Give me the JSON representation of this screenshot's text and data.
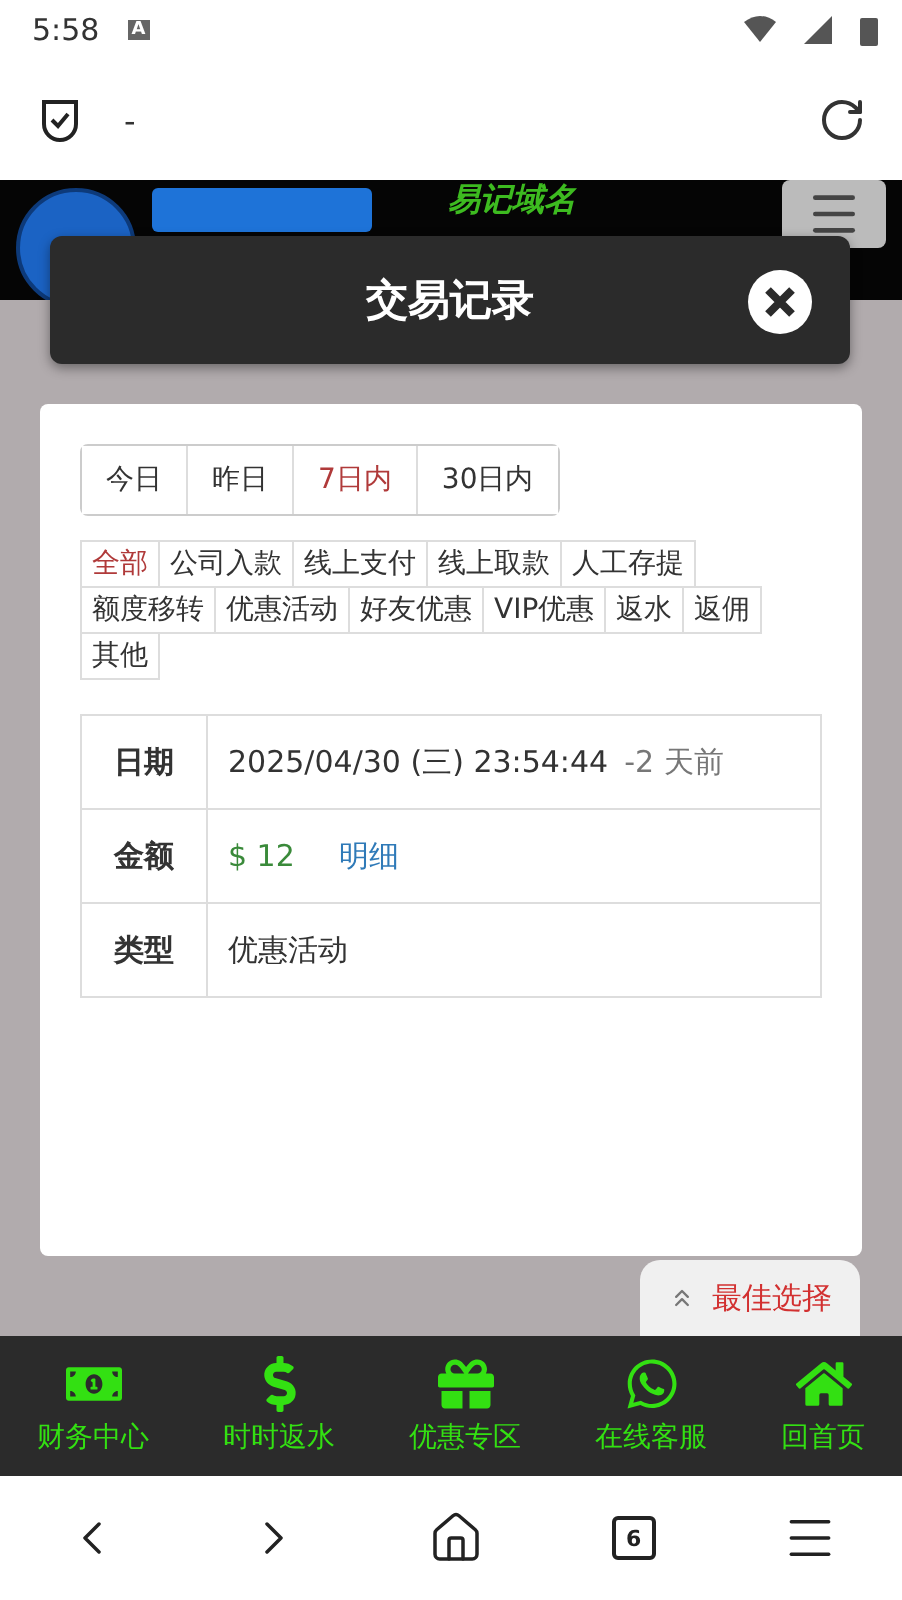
{
  "status_bar": {
    "time": "5:58",
    "badge": "A"
  },
  "browser": {
    "url": "-",
    "tab_count": "6"
  },
  "site_header": {
    "slogan": "易记域名"
  },
  "modal": {
    "title": "交易记录",
    "periods": [
      {
        "label": "今日",
        "selected": false
      },
      {
        "label": "昨日",
        "selected": false
      },
      {
        "label": "7日内",
        "selected": true
      },
      {
        "label": "30日内",
        "selected": false
      }
    ],
    "filters": [
      {
        "label": "全部",
        "selected": true
      },
      {
        "label": "公司入款",
        "selected": false
      },
      {
        "label": "线上支付",
        "selected": false
      },
      {
        "label": "线上取款",
        "selected": false
      },
      {
        "label": "人工存提",
        "selected": false
      },
      {
        "label": "额度移转",
        "selected": false
      },
      {
        "label": "优惠活动",
        "selected": false
      },
      {
        "label": "好友优惠",
        "selected": false
      },
      {
        "label": "VIP优惠",
        "selected": false
      },
      {
        "label": "返水",
        "selected": false
      },
      {
        "label": "返佣",
        "selected": false
      },
      {
        "label": "其他",
        "selected": false
      }
    ],
    "details": [
      {
        "kind": "datetime",
        "label": "日期",
        "value": "2025/04/30 (三) 23:54:44",
        "suffix": "-2 天前"
      },
      {
        "kind": "amount",
        "label": "金额",
        "value": "$ 12",
        "link": "明细"
      },
      {
        "kind": "text",
        "label": "类型",
        "value": "优惠活动"
      }
    ]
  },
  "float_button": {
    "label": "最佳选择"
  },
  "bottom_nav": [
    {
      "kind": "finance",
      "label": "财务中心"
    },
    {
      "kind": "rebate",
      "label": "时时返水"
    },
    {
      "kind": "promo",
      "label": "优惠专区"
    },
    {
      "kind": "support",
      "label": "在线客服"
    },
    {
      "kind": "home",
      "label": "回首页"
    }
  ]
}
